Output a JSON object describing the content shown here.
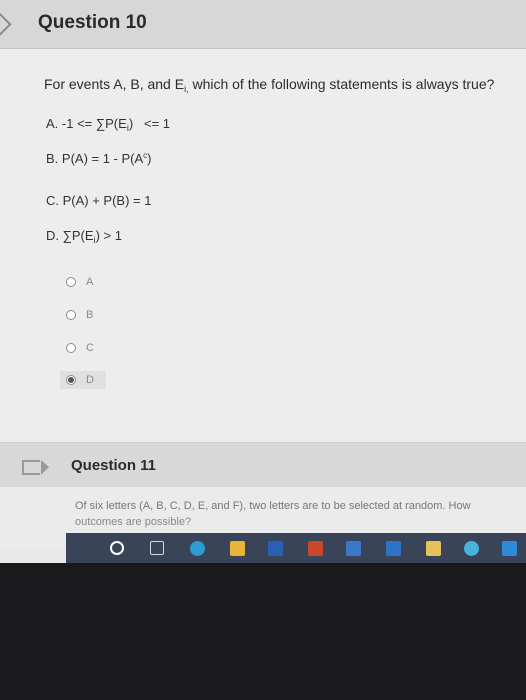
{
  "question10": {
    "title": "Question 10",
    "prompt": "For events A, B, and E",
    "prompt_sub": "i,",
    "prompt_rest": " which of the following statements is always true?",
    "statements": [
      {
        "prefix": "A. -1 <= ∑P(E",
        "sub": "i",
        "suffix": ")   <= 1"
      },
      {
        "prefix": "B. P(A) = 1 - P(A",
        "sup": "c",
        "suffix": ")"
      },
      {
        "text": "C. P(A) + P(B) = 1"
      },
      {
        "prefix": "D. ∑P(E",
        "sub": "i",
        "suffix": ") > 1"
      }
    ],
    "choices": [
      {
        "label": "A",
        "selected": false
      },
      {
        "label": "B",
        "selected": false
      },
      {
        "label": "C",
        "selected": false
      },
      {
        "label": "D",
        "selected": true
      }
    ]
  },
  "question11": {
    "title": "Question 11",
    "line1": "Of six letters (A, B, C, D, E, and F), two letters are to be selected at random. How",
    "line2": "outcomes are possible?"
  },
  "taskbar": {
    "icons": [
      "search-icon",
      "task-view-icon",
      "edge-icon",
      "file-explorer-icon",
      "word-icon",
      "powerpoint-icon",
      "store-icon",
      "mail-icon",
      "calendar-icon",
      "photos-icon",
      "app-icon"
    ]
  }
}
